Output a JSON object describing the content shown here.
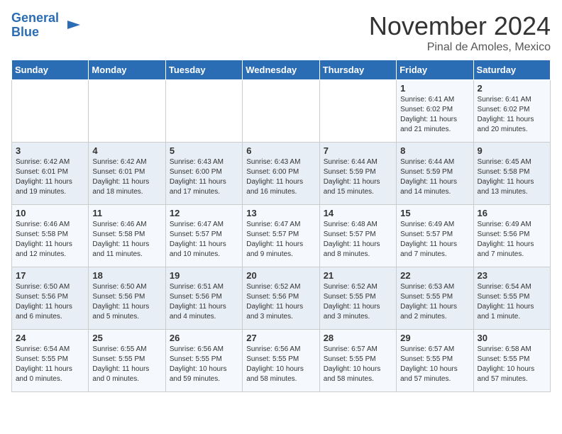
{
  "logo": {
    "line1": "General",
    "line2": "Blue"
  },
  "title": "November 2024",
  "subtitle": "Pinal de Amoles, Mexico",
  "days_of_week": [
    "Sunday",
    "Monday",
    "Tuesday",
    "Wednesday",
    "Thursday",
    "Friday",
    "Saturday"
  ],
  "weeks": [
    [
      {
        "day": "",
        "info": ""
      },
      {
        "day": "",
        "info": ""
      },
      {
        "day": "",
        "info": ""
      },
      {
        "day": "",
        "info": ""
      },
      {
        "day": "",
        "info": ""
      },
      {
        "day": "1",
        "info": "Sunrise: 6:41 AM\nSunset: 6:02 PM\nDaylight: 11 hours\nand 21 minutes."
      },
      {
        "day": "2",
        "info": "Sunrise: 6:41 AM\nSunset: 6:02 PM\nDaylight: 11 hours\nand 20 minutes."
      }
    ],
    [
      {
        "day": "3",
        "info": "Sunrise: 6:42 AM\nSunset: 6:01 PM\nDaylight: 11 hours\nand 19 minutes."
      },
      {
        "day": "4",
        "info": "Sunrise: 6:42 AM\nSunset: 6:01 PM\nDaylight: 11 hours\nand 18 minutes."
      },
      {
        "day": "5",
        "info": "Sunrise: 6:43 AM\nSunset: 6:00 PM\nDaylight: 11 hours\nand 17 minutes."
      },
      {
        "day": "6",
        "info": "Sunrise: 6:43 AM\nSunset: 6:00 PM\nDaylight: 11 hours\nand 16 minutes."
      },
      {
        "day": "7",
        "info": "Sunrise: 6:44 AM\nSunset: 5:59 PM\nDaylight: 11 hours\nand 15 minutes."
      },
      {
        "day": "8",
        "info": "Sunrise: 6:44 AM\nSunset: 5:59 PM\nDaylight: 11 hours\nand 14 minutes."
      },
      {
        "day": "9",
        "info": "Sunrise: 6:45 AM\nSunset: 5:58 PM\nDaylight: 11 hours\nand 13 minutes."
      }
    ],
    [
      {
        "day": "10",
        "info": "Sunrise: 6:46 AM\nSunset: 5:58 PM\nDaylight: 11 hours\nand 12 minutes."
      },
      {
        "day": "11",
        "info": "Sunrise: 6:46 AM\nSunset: 5:58 PM\nDaylight: 11 hours\nand 11 minutes."
      },
      {
        "day": "12",
        "info": "Sunrise: 6:47 AM\nSunset: 5:57 PM\nDaylight: 11 hours\nand 10 minutes."
      },
      {
        "day": "13",
        "info": "Sunrise: 6:47 AM\nSunset: 5:57 PM\nDaylight: 11 hours\nand 9 minutes."
      },
      {
        "day": "14",
        "info": "Sunrise: 6:48 AM\nSunset: 5:57 PM\nDaylight: 11 hours\nand 8 minutes."
      },
      {
        "day": "15",
        "info": "Sunrise: 6:49 AM\nSunset: 5:57 PM\nDaylight: 11 hours\nand 7 minutes."
      },
      {
        "day": "16",
        "info": "Sunrise: 6:49 AM\nSunset: 5:56 PM\nDaylight: 11 hours\nand 7 minutes."
      }
    ],
    [
      {
        "day": "17",
        "info": "Sunrise: 6:50 AM\nSunset: 5:56 PM\nDaylight: 11 hours\nand 6 minutes."
      },
      {
        "day": "18",
        "info": "Sunrise: 6:50 AM\nSunset: 5:56 PM\nDaylight: 11 hours\nand 5 minutes."
      },
      {
        "day": "19",
        "info": "Sunrise: 6:51 AM\nSunset: 5:56 PM\nDaylight: 11 hours\nand 4 minutes."
      },
      {
        "day": "20",
        "info": "Sunrise: 6:52 AM\nSunset: 5:56 PM\nDaylight: 11 hours\nand 3 minutes."
      },
      {
        "day": "21",
        "info": "Sunrise: 6:52 AM\nSunset: 5:55 PM\nDaylight: 11 hours\nand 3 minutes."
      },
      {
        "day": "22",
        "info": "Sunrise: 6:53 AM\nSunset: 5:55 PM\nDaylight: 11 hours\nand 2 minutes."
      },
      {
        "day": "23",
        "info": "Sunrise: 6:54 AM\nSunset: 5:55 PM\nDaylight: 11 hours\nand 1 minute."
      }
    ],
    [
      {
        "day": "24",
        "info": "Sunrise: 6:54 AM\nSunset: 5:55 PM\nDaylight: 11 hours\nand 0 minutes."
      },
      {
        "day": "25",
        "info": "Sunrise: 6:55 AM\nSunset: 5:55 PM\nDaylight: 11 hours\nand 0 minutes."
      },
      {
        "day": "26",
        "info": "Sunrise: 6:56 AM\nSunset: 5:55 PM\nDaylight: 10 hours\nand 59 minutes."
      },
      {
        "day": "27",
        "info": "Sunrise: 6:56 AM\nSunset: 5:55 PM\nDaylight: 10 hours\nand 58 minutes."
      },
      {
        "day": "28",
        "info": "Sunrise: 6:57 AM\nSunset: 5:55 PM\nDaylight: 10 hours\nand 58 minutes."
      },
      {
        "day": "29",
        "info": "Sunrise: 6:57 AM\nSunset: 5:55 PM\nDaylight: 10 hours\nand 57 minutes."
      },
      {
        "day": "30",
        "info": "Sunrise: 6:58 AM\nSunset: 5:55 PM\nDaylight: 10 hours\nand 57 minutes."
      }
    ]
  ]
}
